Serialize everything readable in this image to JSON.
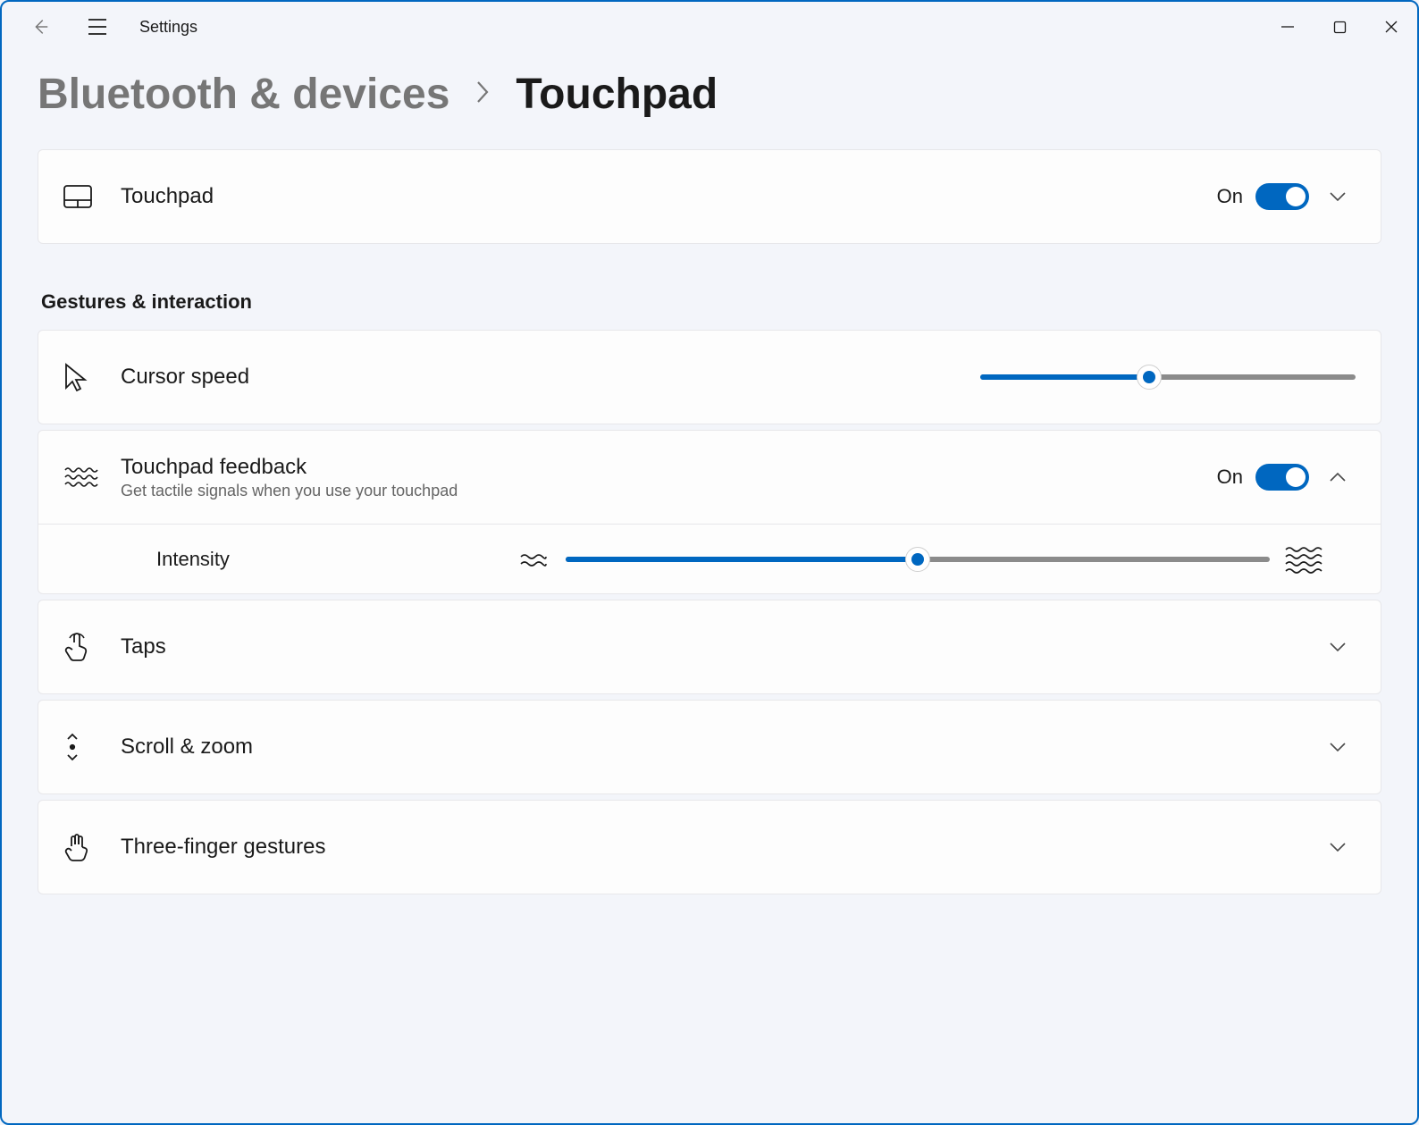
{
  "app": {
    "title": "Settings"
  },
  "breadcrumb": {
    "parent": "Bluetooth & devices",
    "current": "Touchpad"
  },
  "touchpad": {
    "label": "Touchpad",
    "state": "On",
    "on": true
  },
  "section": {
    "gestures": "Gestures & interaction"
  },
  "cursor_speed": {
    "label": "Cursor speed",
    "value": 45
  },
  "feedback": {
    "label": "Touchpad feedback",
    "sub": "Get tactile signals when you use your touchpad",
    "state": "On",
    "on": true,
    "expanded": true,
    "intensity_label": "Intensity",
    "intensity_value": 50
  },
  "taps": {
    "label": "Taps"
  },
  "scroll_zoom": {
    "label": "Scroll & zoom"
  },
  "three_finger": {
    "label": "Three-finger gestures"
  }
}
